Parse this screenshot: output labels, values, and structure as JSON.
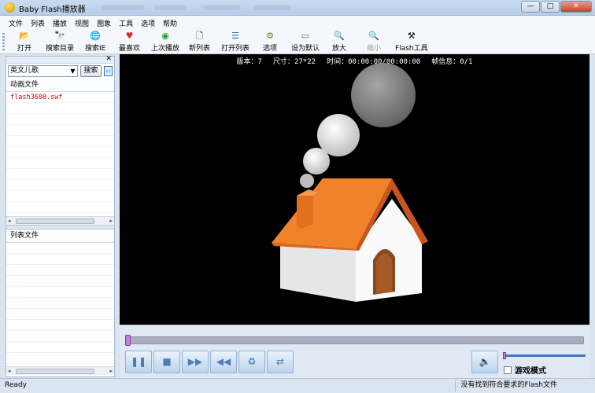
{
  "window": {
    "title": "Baby Flash播放器",
    "controls": {
      "minimize": "—",
      "maximize": "□",
      "close": "✕"
    }
  },
  "menu": [
    "文件",
    "列表",
    "播放",
    "视图",
    "图象",
    "工具",
    "选项",
    "帮助"
  ],
  "toolbar": [
    {
      "label": "打开",
      "icon": "folder-open-icon",
      "glyph": "📂",
      "enabled": true
    },
    {
      "label": "搜索目录",
      "icon": "binoculars-icon",
      "glyph": "🔭",
      "enabled": true
    },
    {
      "label": "搜索IE",
      "icon": "globe-icon",
      "glyph": "🌐",
      "enabled": true
    },
    {
      "label": "最喜欢",
      "icon": "heart-icon",
      "glyph": "♥",
      "enabled": true
    },
    {
      "label": "上次播放",
      "icon": "green-play-icon",
      "glyph": "◉",
      "enabled": true
    },
    {
      "label": "新列表",
      "icon": "new-document-icon",
      "glyph": "🗋",
      "enabled": true
    },
    {
      "label": "打开列表",
      "icon": "open-list-icon",
      "glyph": "☰",
      "enabled": true
    },
    {
      "label": "选项",
      "icon": "options-icon",
      "glyph": "⚙",
      "enabled": true
    },
    {
      "label": "设为默认",
      "icon": "window-default-icon",
      "glyph": "▭",
      "enabled": true
    },
    {
      "label": "放大",
      "icon": "zoom-in-icon",
      "glyph": "🔍",
      "enabled": true
    },
    {
      "label": "缩小",
      "icon": "zoom-out-icon",
      "glyph": "🔍",
      "enabled": false
    },
    {
      "label": "Flash工具",
      "icon": "tools-icon",
      "glyph": "⚒",
      "enabled": true
    }
  ],
  "left_panel": {
    "category": "英文儿歌",
    "search_button": "搜索",
    "animation_header": "动画文件",
    "files": [
      "flash3680.swf"
    ],
    "list_header": "列表文件"
  },
  "info": {
    "version": "版本：7",
    "size": "尺寸：27*22",
    "time": "时间：00:00:00/00:00:00",
    "frames": "帧信息：0/1"
  },
  "player": {
    "seek_fraction": 0.0,
    "volume_fraction": 0.0,
    "buttons": [
      {
        "name": "pause-button",
        "icon": "pause-icon",
        "glyph": "❚❚"
      },
      {
        "name": "stop-button",
        "icon": "stop-icon",
        "glyph": "■"
      },
      {
        "name": "forward-button",
        "icon": "fast-forward-icon",
        "glyph": "▶▶"
      },
      {
        "name": "rewind-button",
        "icon": "rewind-icon",
        "glyph": "◀◀"
      },
      {
        "name": "loop-button",
        "icon": "recycle-icon",
        "glyph": "♻"
      },
      {
        "name": "repeat-button",
        "icon": "repeat-icon",
        "glyph": "⇄"
      }
    ],
    "game_mode": "游戏模式"
  },
  "status": {
    "left": "Ready",
    "right": "没有找到符合要求的Flash文件"
  }
}
